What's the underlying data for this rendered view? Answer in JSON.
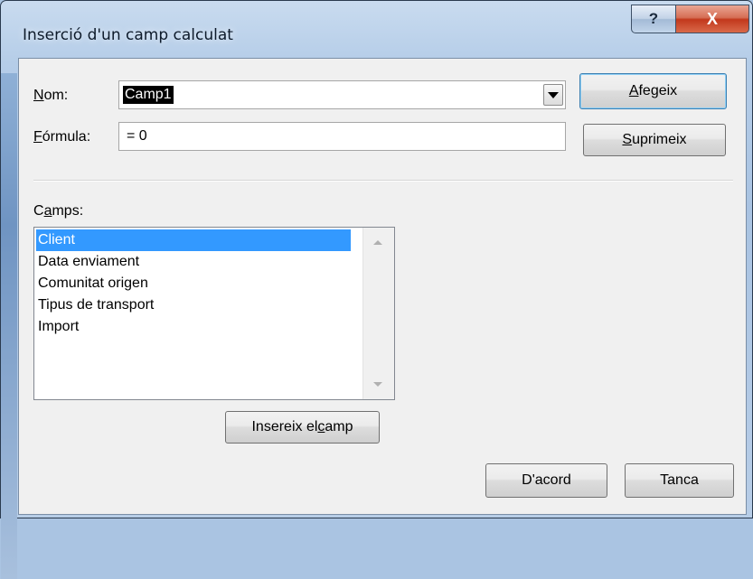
{
  "window": {
    "title": "Inserció d'un camp calculat",
    "help_glyph": "?",
    "close_glyph": "X"
  },
  "form": {
    "name_label_underlined": "N",
    "name_label_rest": "om:",
    "name_value": "Camp1",
    "formula_label_underlined": "F",
    "formula_label_rest": "órmula:",
    "formula_value": "= 0"
  },
  "buttons": {
    "add_underlined": "A",
    "add_rest": "fegeix",
    "delete_underlined": "S",
    "delete_rest": "uprimeix",
    "insert_field_pre": "Insereix el ",
    "insert_field_underlined": "c",
    "insert_field_post": "amp",
    "ok": "D'acord",
    "close": "Tanca"
  },
  "fields": {
    "label_pre": "C",
    "label_underlined": "a",
    "label_post": "mps:",
    "items": [
      {
        "label": "Client",
        "selected": true
      },
      {
        "label": "Data enviament",
        "selected": false
      },
      {
        "label": "Comunitat origen",
        "selected": false
      },
      {
        "label": "Tipus de transport",
        "selected": false
      },
      {
        "label": "Import",
        "selected": false
      }
    ]
  },
  "colors": {
    "selection": "#3399ff",
    "close_button": "#c2381c"
  }
}
